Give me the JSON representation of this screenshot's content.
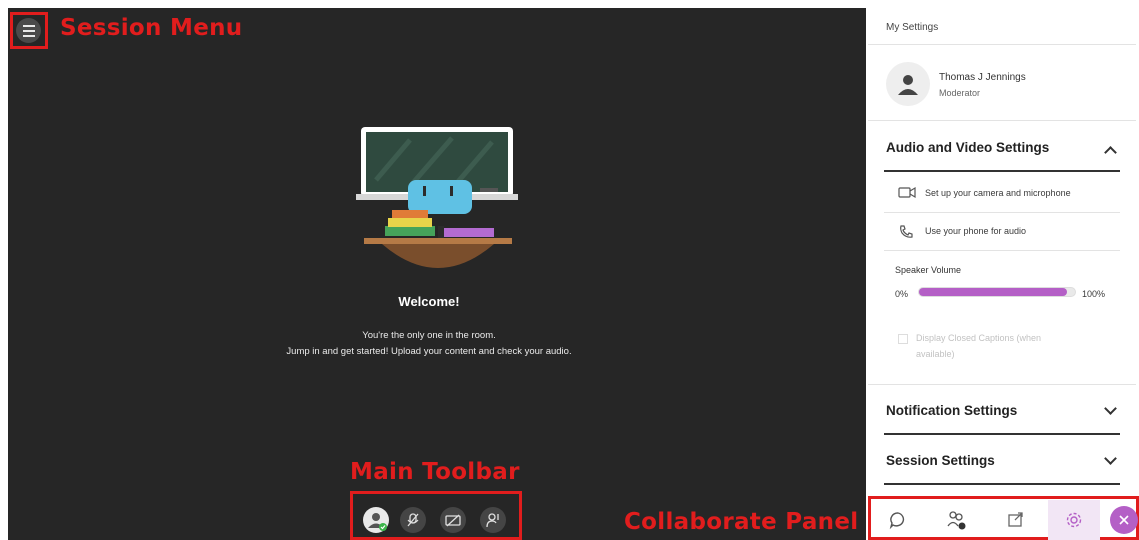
{
  "annotations": {
    "session_menu": "Session Menu",
    "main_toolbar": "Main Toolbar",
    "collaborate_panel": "Collaborate Panel"
  },
  "stage": {
    "welcome_title": "Welcome!",
    "line1": "You're the only one in the room.",
    "line2": "Jump in and get started! Upload your content and check your audio."
  },
  "toolbar": {
    "icons": [
      "avatar-icon",
      "microphone-off-icon",
      "camera-off-icon",
      "raise-hand-icon"
    ]
  },
  "panel": {
    "header": "My Settings",
    "user_name": "Thomas J Jennings",
    "user_role": "Moderator",
    "audio_video": "Audio and Video Settings",
    "setup_camera": "Set up your camera and microphone",
    "use_phone": "Use your phone for audio",
    "speaker_volume": "Speaker Volume",
    "vol_min": "0%",
    "vol_max": "100%",
    "volume_level": 0.95,
    "captions_line1": "Display Closed Captions (when",
    "captions_line2": "available)",
    "notification_settings": "Notification Settings",
    "session_settings": "Session Settings"
  },
  "colors": {
    "annotation": "#e11d1d",
    "stage_bg": "#262626",
    "accent_purple": "#b45fc6"
  }
}
